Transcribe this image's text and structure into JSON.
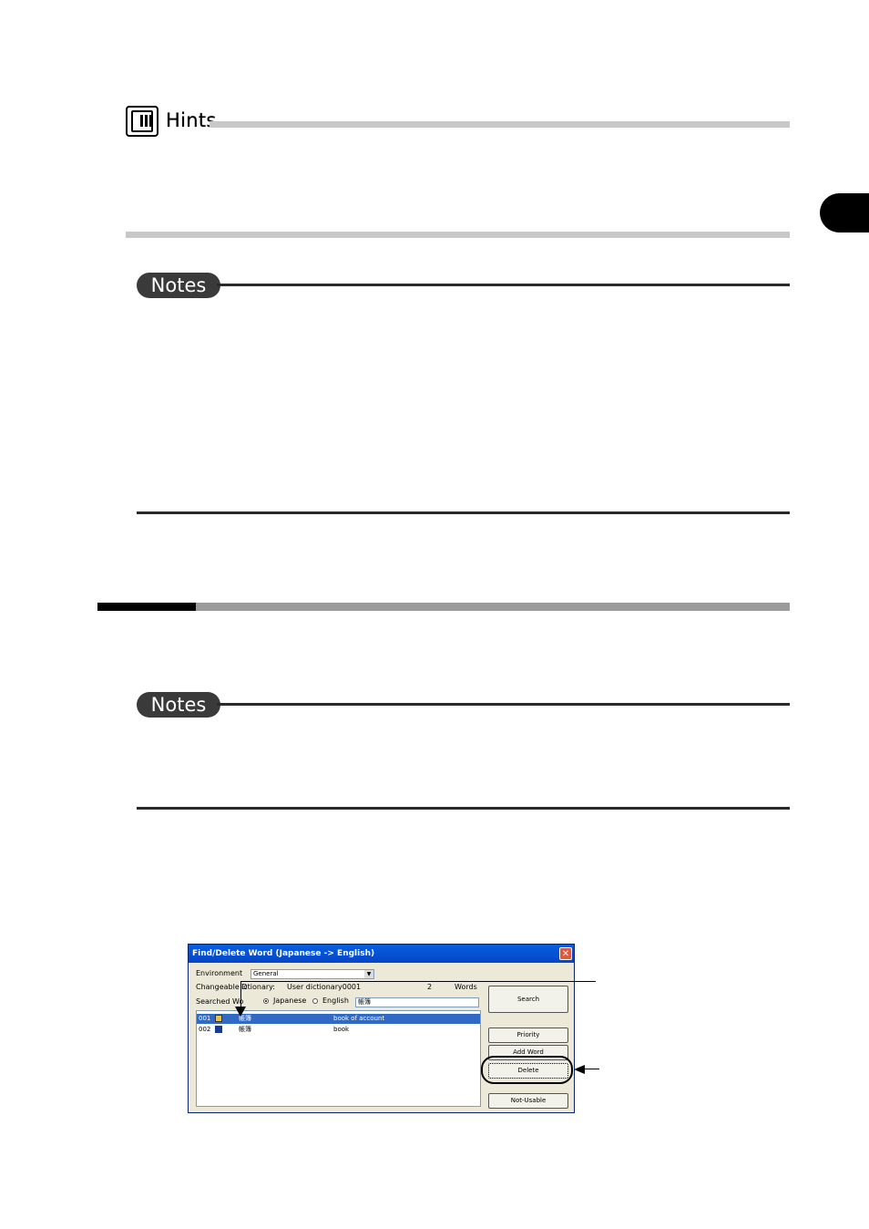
{
  "hints": {
    "label": "Hints"
  },
  "notes": {
    "label_1": "Notes",
    "label_2": "Notes"
  },
  "dialog": {
    "title": "Find/Delete Word (Japanese -> English)",
    "close_glyph": "✕",
    "environment_label": "Environment",
    "environment_value": "General",
    "changeable_label": "Changeable D",
    "dictionary_label": "ictionary:",
    "dictionary_value": "User dictionary0001",
    "word_count": "2",
    "words_label": "Words",
    "searched_word_label": "Searched Wo",
    "radio_japanese": "Japanese",
    "radio_english": "English",
    "search_value": "帳簿",
    "rows": [
      {
        "num": "001",
        "jp": "帳簿",
        "en": "book of account"
      },
      {
        "num": "002",
        "jp": "帳簿",
        "en": "book"
      }
    ],
    "buttons": {
      "search": "Search",
      "priority": "Priority",
      "add_word": "Add Word",
      "delete": "Delete",
      "not_usable": "Not-Usable"
    }
  }
}
